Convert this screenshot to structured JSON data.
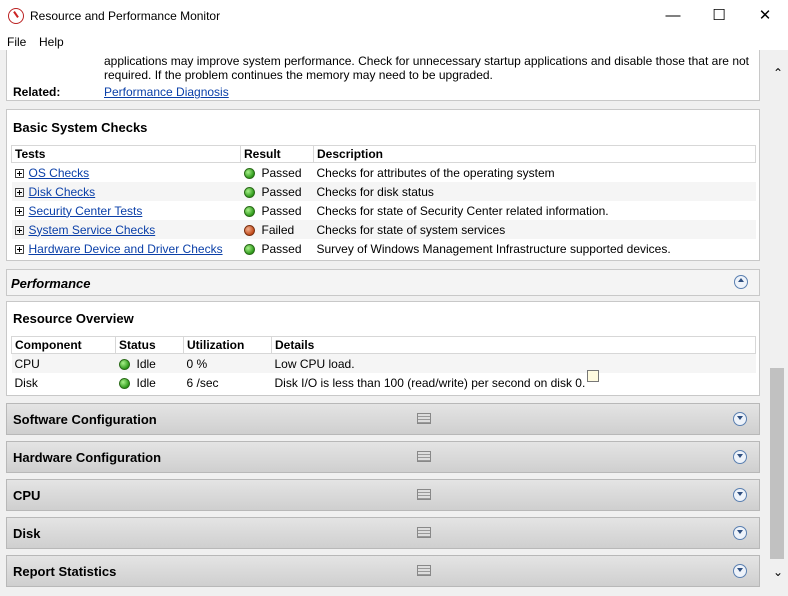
{
  "window": {
    "title": "Resource and Performance Monitor",
    "minimize": "—",
    "maximize": "☐",
    "close": "✕"
  },
  "menu": {
    "file": "File",
    "help": "Help"
  },
  "symptom": {
    "line1": "applications may improve system performance. Check for unnecessary startup applications and disable those that are not",
    "line2": "required. If the problem continues the memory may need to be upgraded.",
    "related_label": "Related:",
    "related_link": "Performance Diagnosis"
  },
  "basic_checks": {
    "title": "Basic System Checks",
    "headers": [
      "Tests",
      "Result",
      "Description"
    ],
    "rows": [
      {
        "test": "OS Checks",
        "status": "ok",
        "result": "Passed",
        "description": "Checks for attributes of the operating system"
      },
      {
        "test": "Disk Checks",
        "status": "ok",
        "result": "Passed",
        "description": "Checks for disk status"
      },
      {
        "test": "Security Center Tests",
        "status": "ok",
        "result": "Passed",
        "description": "Checks for state of Security Center related information."
      },
      {
        "test": "System Service Checks",
        "status": "fail",
        "result": "Failed",
        "description": "Checks for state of system services"
      },
      {
        "test": "Hardware Device and Driver Checks",
        "status": "ok",
        "result": "Passed",
        "description": "Survey of Windows Management Infrastructure supported devices."
      }
    ]
  },
  "performance": {
    "title": "Performance"
  },
  "resource_overview": {
    "title": "Resource Overview",
    "headers": [
      "Component",
      "Status",
      "Utilization",
      "Details"
    ],
    "rows": [
      {
        "component": "CPU",
        "status": "Idle",
        "utilization": "0 %",
        "details": "Low CPU load."
      },
      {
        "component": "Disk",
        "status": "Idle",
        "utilization": "6 /sec",
        "details": "Disk I/O is less than 100 (read/write) per second on disk 0."
      }
    ]
  },
  "sections": [
    "Software Configuration",
    "Hardware Configuration",
    "CPU",
    "Disk",
    "Report Statistics"
  ],
  "colors": {
    "link": "#0a3fa8",
    "passed": "#2e9a1a",
    "failed": "#c24a1a"
  }
}
